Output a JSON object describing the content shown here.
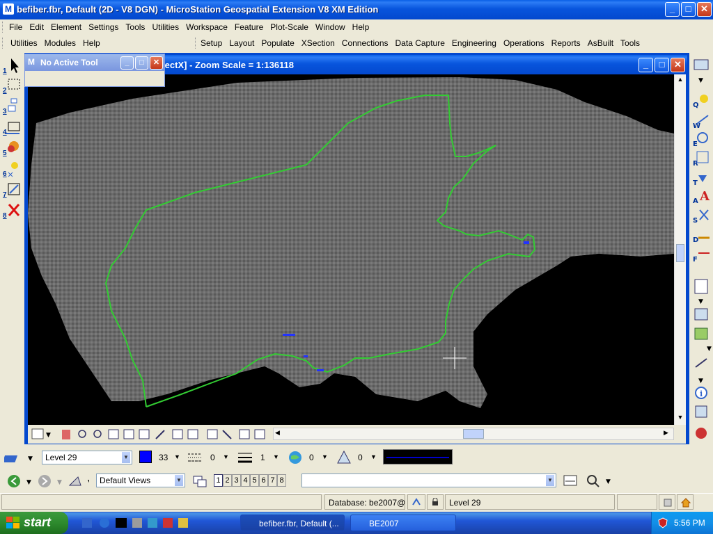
{
  "app": {
    "title": "befiber.fbr, Default (2D - V8 DGN) - MicroStation Geospatial Extension V8 XM Edition",
    "icon_letter": "M"
  },
  "window_controls": {
    "minimize": "_",
    "maximize": "□",
    "close": "✕"
  },
  "menu1": [
    "File",
    "Edit",
    "Element",
    "Settings",
    "Tools",
    "Utilities",
    "Workspace",
    "Feature",
    "Plot-Scale",
    "Window",
    "Help"
  ],
  "menu2a": [
    "Utilities",
    "Modules",
    "Help"
  ],
  "menu2b": [
    "Setup",
    "Layout",
    "Populate",
    "XSection",
    "Connections",
    "Data Capture",
    "Engineering",
    "Operations",
    "Reports",
    "AsBuilt",
    "Tools"
  ],
  "tool_settings": {
    "title": "No Active Tool"
  },
  "view": {
    "title": "irectX] - Zoom Scale = 1:136118"
  },
  "left_tool_numbers": [
    "1",
    "2",
    "3",
    "4",
    "5",
    "6",
    "7",
    "8"
  ],
  "right_tool_letters": [
    "Q",
    "W",
    "E",
    "R",
    "T",
    "A",
    "S",
    "D",
    "F"
  ],
  "attributes": {
    "level": "Level 29",
    "color_index": "33",
    "color_swatch": "#0000FF",
    "style": "0",
    "weight": "1",
    "transparency": "0",
    "priority": "0",
    "line_preview_color": "#0000CC"
  },
  "views_bar": {
    "saved_view": "Default Views",
    "view_numbers": [
      "1",
      "2",
      "3",
      "4",
      "5",
      "6",
      "7",
      "8"
    ],
    "input_value": ""
  },
  "statusbar": {
    "database": "Database: be2007@",
    "level": "Level 29"
  },
  "taskbar": {
    "start_label": "start",
    "items": [
      "befiber.fbr, Default (...",
      "BE2007"
    ],
    "clock": "5:56 PM"
  },
  "colors": {
    "boundary": "#33CC33",
    "title_blue": "#0348CE"
  }
}
